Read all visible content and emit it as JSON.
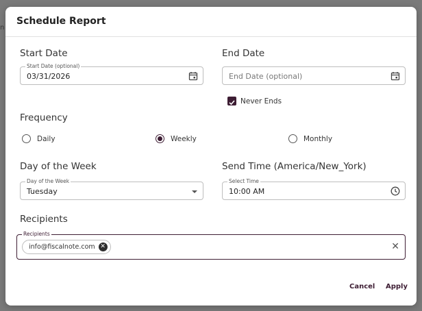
{
  "background": {
    "hint_text": "n 2"
  },
  "dialog": {
    "title": "Schedule Report",
    "start_date": {
      "heading": "Start Date",
      "float_label": "Start Date (optional)",
      "value": "03/31/2026",
      "icon": "calendar-icon"
    },
    "end_date": {
      "heading": "End Date",
      "placeholder": "End Date (optional)",
      "icon": "calendar-icon"
    },
    "never_ends": {
      "label": "Never Ends",
      "checked": true
    },
    "frequency": {
      "heading": "Frequency",
      "options": [
        {
          "label": "Daily",
          "selected": false
        },
        {
          "label": "Weekly",
          "selected": true
        },
        {
          "label": "Monthly",
          "selected": false
        }
      ]
    },
    "day_of_week": {
      "heading": "Day of the Week",
      "float_label": "Day of the Week",
      "value": "Tuesday"
    },
    "send_time": {
      "heading": "Send Time (America/New_York)",
      "float_label": "Select Time",
      "value": "10:00 AM",
      "icon": "clock-icon"
    },
    "recipients": {
      "heading": "Recipients",
      "float_label": "Recipients",
      "chips": [
        "info@fiscalnote.com"
      ],
      "clear_icon": "close-icon"
    },
    "buttons": {
      "cancel": "Cancel",
      "apply": "Apply"
    }
  },
  "colors": {
    "accent": "#3d1d33",
    "backdrop": "#6f6f6f"
  }
}
